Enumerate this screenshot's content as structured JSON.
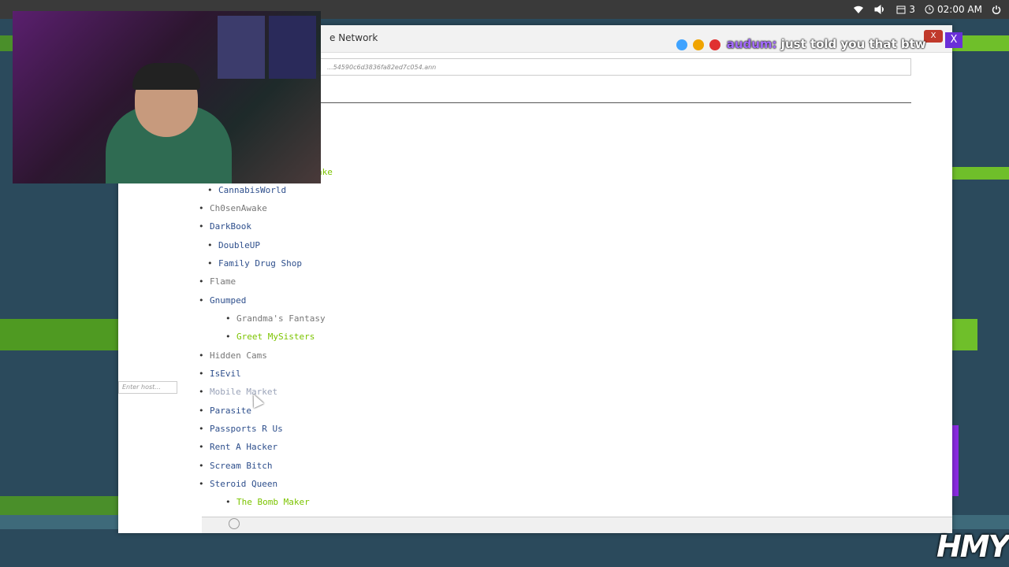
{
  "top_panel": {
    "calendar_count": "3",
    "clock": "02:00 AM"
  },
  "window": {
    "title": "e Network",
    "close_label": "X",
    "address": "...54590c6d3836fa82ed7c054.ann",
    "enter_host_placeholder": "Enter host..."
  },
  "partial_text": "ake",
  "links": [
    {
      "label": "CannabisWorld",
      "style": "blue"
    },
    {
      "label": "Ch0senAwake",
      "style": "glitch"
    },
    {
      "label": "DarkBook",
      "style": "blue"
    },
    {
      "label": "DoubleUP",
      "style": "blue"
    },
    {
      "label": "Family Drug Shop",
      "style": "blue"
    },
    {
      "label": "Flame",
      "style": "glitch"
    },
    {
      "label": "Gnumped",
      "style": "blue"
    },
    {
      "label": "Grandma's Fantasy",
      "style": "glitch"
    },
    {
      "label": "Greet MySisters",
      "style": "green"
    },
    {
      "label": "Hidden Cams",
      "style": "glitch"
    },
    {
      "label": "IsEvil",
      "style": "blue"
    },
    {
      "label": "Mobile Market",
      "style": "faded"
    },
    {
      "label": "Parasite",
      "style": "blue"
    },
    {
      "label": "Passports R Us",
      "style": "blue"
    },
    {
      "label": "Rent A Hacker",
      "style": "blue"
    },
    {
      "label": "Scream Bitch",
      "style": "blue"
    },
    {
      "label": "Steroid Queen",
      "style": "blue"
    },
    {
      "label": "The Bomb Maker",
      "style": "green"
    }
  ],
  "chat": {
    "username": "audum:",
    "message": "just told you that btw",
    "close_label": "X"
  },
  "watermark": "HMY",
  "colors": {
    "link_blue": "#2e4f8c",
    "link_green": "#7cc400",
    "chat_user": "#a46bff",
    "chat_close": "#6a2fd8"
  }
}
